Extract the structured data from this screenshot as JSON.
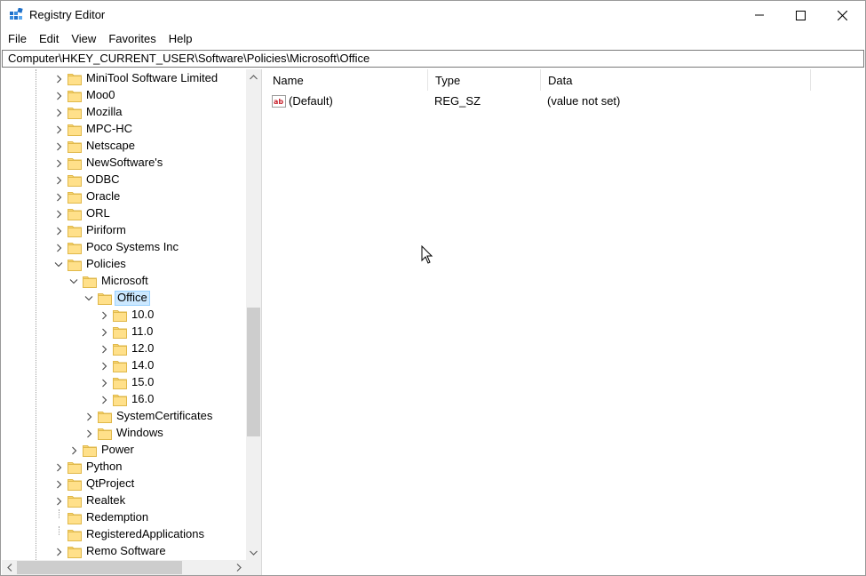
{
  "window": {
    "title": "Registry Editor"
  },
  "menu": [
    "File",
    "Edit",
    "View",
    "Favorites",
    "Help"
  ],
  "address": "Computer\\HKEY_CURRENT_USER\\Software\\Policies\\Microsoft\\Office",
  "tree": [
    {
      "label": "MiniTool Software Limited",
      "level": 0,
      "state": "collapsed"
    },
    {
      "label": "Moo0",
      "level": 0,
      "state": "collapsed"
    },
    {
      "label": "Mozilla",
      "level": 0,
      "state": "collapsed"
    },
    {
      "label": "MPC-HC",
      "level": 0,
      "state": "collapsed"
    },
    {
      "label": "Netscape",
      "level": 0,
      "state": "collapsed"
    },
    {
      "label": "NewSoftware's",
      "level": 0,
      "state": "collapsed"
    },
    {
      "label": "ODBC",
      "level": 0,
      "state": "collapsed"
    },
    {
      "label": "Oracle",
      "level": 0,
      "state": "collapsed"
    },
    {
      "label": "ORL",
      "level": 0,
      "state": "collapsed"
    },
    {
      "label": "Piriform",
      "level": 0,
      "state": "collapsed"
    },
    {
      "label": "Poco Systems Inc",
      "level": 0,
      "state": "collapsed"
    },
    {
      "label": "Policies",
      "level": 0,
      "state": "expanded"
    },
    {
      "label": "Microsoft",
      "level": 1,
      "state": "expanded"
    },
    {
      "label": "Office",
      "level": 2,
      "state": "expanded",
      "selected": true
    },
    {
      "label": "10.0",
      "level": 3,
      "state": "collapsed"
    },
    {
      "label": "11.0",
      "level": 3,
      "state": "collapsed"
    },
    {
      "label": "12.0",
      "level": 3,
      "state": "collapsed"
    },
    {
      "label": "14.0",
      "level": 3,
      "state": "collapsed"
    },
    {
      "label": "15.0",
      "level": 3,
      "state": "collapsed"
    },
    {
      "label": "16.0",
      "level": 3,
      "state": "collapsed"
    },
    {
      "label": "SystemCertificates",
      "level": 2,
      "state": "collapsed"
    },
    {
      "label": "Windows",
      "level": 2,
      "state": "collapsed"
    },
    {
      "label": "Power",
      "level": 1,
      "state": "collapsed"
    },
    {
      "label": "Python",
      "level": 0,
      "state": "collapsed"
    },
    {
      "label": "QtProject",
      "level": 0,
      "state": "collapsed"
    },
    {
      "label": "Realtek",
      "level": 0,
      "state": "collapsed"
    },
    {
      "label": "Redemption",
      "level": 0,
      "state": "leaf"
    },
    {
      "label": "RegisteredApplications",
      "level": 0,
      "state": "leaf"
    },
    {
      "label": "Remo Software",
      "level": 0,
      "state": "collapsed"
    }
  ],
  "list": {
    "columns": [
      "Name",
      "Type",
      "Data"
    ],
    "rows": [
      {
        "name": "(Default)",
        "type": "REG_SZ",
        "data": "(value not set)",
        "icon": "string-value-icon"
      }
    ]
  },
  "colors": {
    "selection_bg": "#cce8ff",
    "folder": "#f8d775"
  }
}
